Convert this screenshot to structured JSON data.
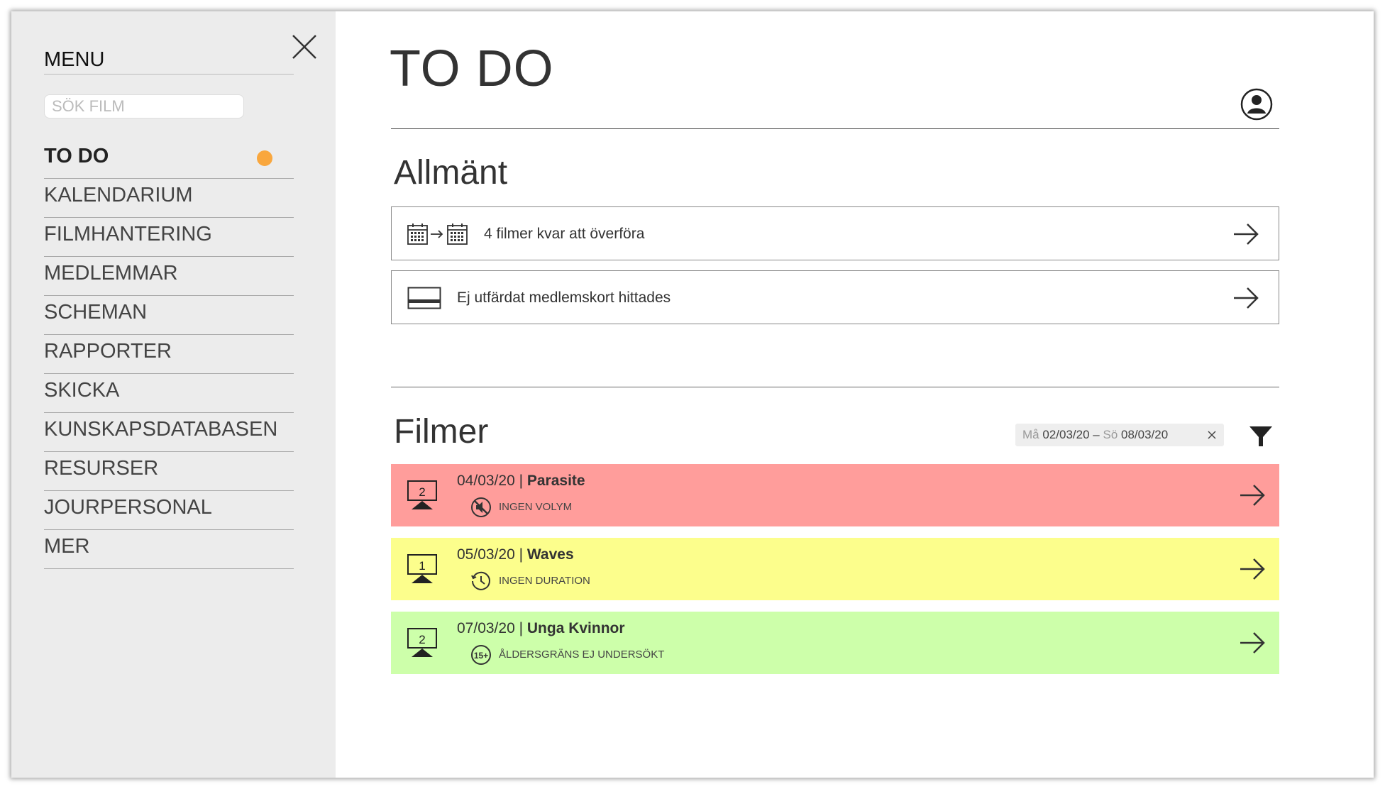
{
  "sidebar": {
    "title": "MENU",
    "search": {
      "placeholder": "SÖK FILM",
      "value": ""
    },
    "items": [
      {
        "label": "TO DO",
        "active": true,
        "badge": true
      },
      {
        "label": "KALENDARIUM"
      },
      {
        "label": "FILMHANTERING"
      },
      {
        "label": "MEDLEMMAR"
      },
      {
        "label": "SCHEMAN"
      },
      {
        "label": "RAPPORTER"
      },
      {
        "label": "SKICKA"
      },
      {
        "label": "KUNSKAPSDATABASEN"
      },
      {
        "label": "RESURSER"
      },
      {
        "label": "JOURPERSONAL"
      },
      {
        "label": "MER"
      }
    ],
    "badge_color": "#f9a73e"
  },
  "main": {
    "title": "TO DO",
    "general": {
      "title": "Allmänt",
      "tasks": [
        {
          "icon": "calendar-transfer-icon",
          "label": "4 filmer kvar att överföra"
        },
        {
          "icon": "card-icon",
          "label": "Ej utfärdat medlemskort hittades"
        }
      ]
    },
    "films": {
      "title": "Filmer",
      "filter": {
        "from_day": "Må",
        "from_date": "02/03/20",
        "separator": "–",
        "to_day": "Sö",
        "to_date": "08/03/20"
      },
      "items": [
        {
          "screen": "2",
          "date": "04/03/20",
          "sep": " | ",
          "name": "Parasite",
          "warning": "INGEN VOLYM",
          "warning_icon": "mute-icon",
          "color": "#ff9d9b"
        },
        {
          "screen": "1",
          "date": "05/03/20",
          "sep": " | ",
          "name": "Waves",
          "warning": "INGEN DURATION",
          "warning_icon": "clock-icon",
          "color": "#fcfe8c"
        },
        {
          "screen": "2",
          "date": "07/03/20",
          "sep": " | ",
          "name": "Unga Kvinnor",
          "warning": "ÅLDERSGRÄNS EJ UNDERSÖKT",
          "warning_icon": "age-15-icon",
          "color": "#cdffaa"
        }
      ]
    }
  }
}
